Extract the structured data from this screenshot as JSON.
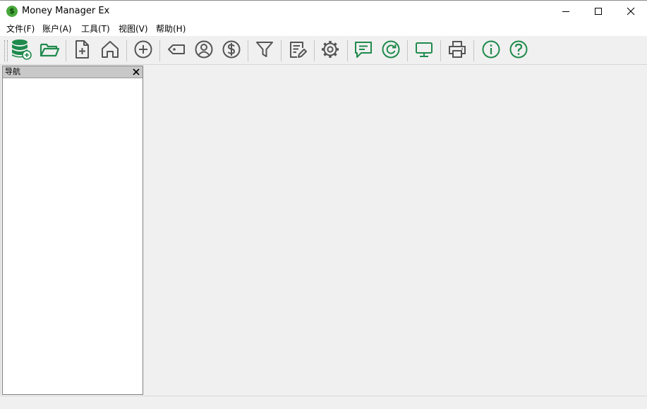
{
  "window": {
    "title": "Money Manager Ex",
    "app_icon_glyph": "$"
  },
  "menu": {
    "items": [
      {
        "label": "文件(F)"
      },
      {
        "label": "账户(A)"
      },
      {
        "label": "工具(T)"
      },
      {
        "label": "视图(V)"
      },
      {
        "label": "帮助(H)"
      }
    ]
  },
  "toolbar": {
    "icons": [
      "new-database-icon",
      "open-database-icon",
      "new-file-icon",
      "home-icon",
      "add-transaction-icon",
      "tag-icon",
      "payee-icon",
      "currency-icon",
      "filter-icon",
      "edit-report-icon",
      "settings-icon",
      "feedback-icon",
      "refresh-icon",
      "display-icon",
      "print-icon",
      "info-icon",
      "help-icon"
    ]
  },
  "navigation": {
    "title": "导航"
  },
  "colors": {
    "accent": "#1f8a4c",
    "icon_gray": "#555555"
  }
}
